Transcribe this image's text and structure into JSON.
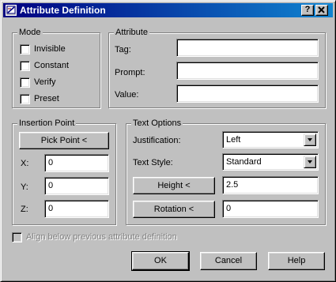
{
  "window": {
    "title": "Attribute Definition",
    "help_label": "?",
    "close_label": "✕"
  },
  "mode": {
    "title": "Mode",
    "options": [
      {
        "label": "Invisible",
        "checked": false
      },
      {
        "label": "Constant",
        "checked": false
      },
      {
        "label": "Verify",
        "checked": false
      },
      {
        "label": "Preset",
        "checked": false
      }
    ]
  },
  "attribute": {
    "title": "Attribute",
    "tag_label": "Tag:",
    "tag_value": "",
    "prompt_label": "Prompt:",
    "prompt_value": "",
    "value_label": "Value:",
    "value_value": ""
  },
  "insertion_point": {
    "title": "Insertion Point",
    "pick_button": "Pick Point <",
    "x_label": "X:",
    "x_value": "0",
    "y_label": "Y:",
    "y_value": "0",
    "z_label": "Z:",
    "z_value": "0"
  },
  "text_options": {
    "title": "Text Options",
    "justification_label": "Justification:",
    "justification_value": "Left",
    "text_style_label": "Text Style:",
    "text_style_value": "Standard",
    "height_button": "Height <",
    "height_value": "2.5",
    "rotation_button": "Rotation <",
    "rotation_value": "0"
  },
  "align_below": {
    "label": "Align below previous attribute definition",
    "checked": false,
    "enabled": false
  },
  "footer": {
    "ok_label": "OK",
    "cancel_label": "Cancel",
    "help_label": "Help"
  }
}
